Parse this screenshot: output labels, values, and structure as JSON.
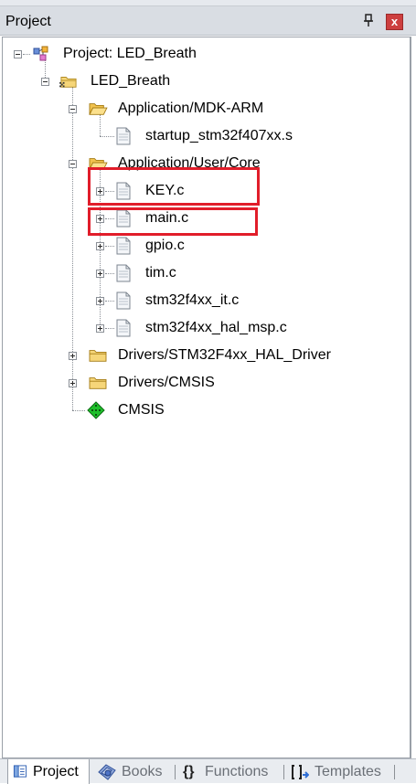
{
  "panel": {
    "title": "Project",
    "close_glyph": "x",
    "pin_icon": "pin-icon"
  },
  "tree": {
    "root": "Project: LED_Breath",
    "target": "LED_Breath",
    "groups": {
      "app_mdk": "Application/MDK-ARM",
      "app_core": "Application/User/Core",
      "drivers_hal": "Drivers/STM32F4xx_HAL_Driver",
      "drivers_cmsis": "Drivers/CMSIS"
    },
    "files": {
      "startup": "startup_stm32f407xx.s",
      "key": "KEY.c",
      "main": "main.c",
      "gpio": "gpio.c",
      "tim": "tim.c",
      "it": "stm32f4xx_it.c",
      "msp": "stm32f4xx_hal_msp.c"
    },
    "cmsis": "CMSIS"
  },
  "tabs": [
    "Project",
    "Books",
    "Functions",
    "Templates"
  ],
  "colors": {
    "highlight": "#e11d2a",
    "titlebar": "#d9dde3",
    "close": "#cd3f3f"
  }
}
